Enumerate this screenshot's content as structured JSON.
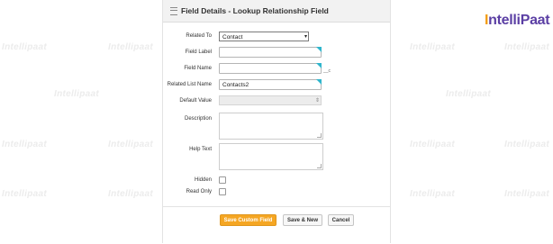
{
  "brand": {
    "logo_prefix": "I",
    "logo_text": "ntelliPaat",
    "watermark": "Intellipaat"
  },
  "header": {
    "title": "Field Details - Lookup Relationship Field",
    "icon": "list-icon"
  },
  "fields": {
    "related_to": {
      "label": "Related To",
      "value": "Contact"
    },
    "field_label": {
      "label": "Field Label",
      "value": ""
    },
    "field_name": {
      "label": "Field Name",
      "value": "",
      "suffix": "__c"
    },
    "related_list_name": {
      "label": "Related List Name",
      "value": "Contacts2"
    },
    "default_value": {
      "label": "Default Value",
      "value": ""
    },
    "description": {
      "label": "Description"
    },
    "help_text": {
      "label": "Help Text"
    },
    "hidden": {
      "label": "Hidden",
      "checked": false
    },
    "read_only": {
      "label": "Read Only",
      "checked": false
    }
  },
  "buttons": {
    "save_custom_field": "Save Custom Field",
    "save_new": "Save & New",
    "cancel": "Cancel"
  },
  "colors": {
    "primary_button": "#f5a623",
    "required_flag": "#2fb5cc",
    "brand": "#5b3fa4"
  }
}
